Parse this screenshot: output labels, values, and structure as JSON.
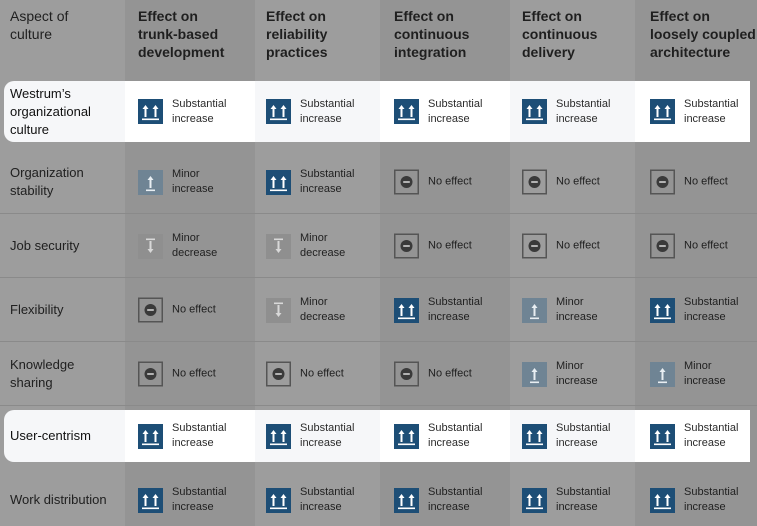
{
  "headers": [
    "Aspect of\nculture",
    "Effect on\ntrunk-based\ndevelopment",
    "Effect on\nreliability\npractices",
    "Effect on\ncontinuous\nintegration",
    "Effect on\ncontinuous\ndelivery",
    "Effect on\nloosely coupled\narchitecture"
  ],
  "colors": {
    "substantial_increase": "#1d4e76",
    "minor_increase": "#6f8494",
    "minor_decrease": "#8f8f8f",
    "no_effect_border": "#555555",
    "overlay_bg": "#9d9d9d",
    "highlight_bg": "#ffffff"
  },
  "rows": [
    {
      "aspect": "Westrum’s\norganizational\nculture",
      "highlighted": true,
      "effects": [
        {
          "type": "substantial_increase",
          "icon": "double-up-arrow-icon",
          "label": "Substantial\nincrease"
        },
        {
          "type": "substantial_increase",
          "icon": "double-up-arrow-icon",
          "label": "Substantial\nincrease"
        },
        {
          "type": "substantial_increase",
          "icon": "double-up-arrow-icon",
          "label": "Substantial\nincrease"
        },
        {
          "type": "substantial_increase",
          "icon": "double-up-arrow-icon",
          "label": "Substantial\nincrease"
        },
        {
          "type": "substantial_increase",
          "icon": "double-up-arrow-icon",
          "label": "Substantial\nincrease"
        }
      ]
    },
    {
      "aspect": "Organization\nstability",
      "highlighted": false,
      "effects": [
        {
          "type": "minor_increase",
          "icon": "up-arrow-icon",
          "label": "Minor\nincrease"
        },
        {
          "type": "substantial_increase",
          "icon": "double-up-arrow-icon",
          "label": "Substantial\nincrease"
        },
        {
          "type": "no_effect",
          "icon": "no-effect-icon",
          "label": "No effect"
        },
        {
          "type": "no_effect",
          "icon": "no-effect-icon",
          "label": "No effect"
        },
        {
          "type": "no_effect",
          "icon": "no-effect-icon",
          "label": "No effect"
        }
      ]
    },
    {
      "aspect": "Job security",
      "highlighted": false,
      "effects": [
        {
          "type": "minor_decrease",
          "icon": "down-arrow-icon",
          "label": "Minor\ndecrease"
        },
        {
          "type": "minor_decrease",
          "icon": "down-arrow-icon",
          "label": "Minor\ndecrease"
        },
        {
          "type": "no_effect",
          "icon": "no-effect-icon",
          "label": "No effect"
        },
        {
          "type": "no_effect",
          "icon": "no-effect-icon",
          "label": "No effect"
        },
        {
          "type": "no_effect",
          "icon": "no-effect-icon",
          "label": "No effect"
        }
      ]
    },
    {
      "aspect": "Flexibility",
      "highlighted": false,
      "effects": [
        {
          "type": "no_effect",
          "icon": "no-effect-icon",
          "label": "No effect"
        },
        {
          "type": "minor_decrease",
          "icon": "down-arrow-icon",
          "label": "Minor\ndecrease"
        },
        {
          "type": "substantial_increase",
          "icon": "double-up-arrow-icon",
          "label": "Substantial\nincrease"
        },
        {
          "type": "minor_increase",
          "icon": "up-arrow-icon",
          "label": "Minor\nincrease"
        },
        {
          "type": "substantial_increase",
          "icon": "double-up-arrow-icon",
          "label": "Substantial\nincrease"
        }
      ]
    },
    {
      "aspect": "Knowledge\nsharing",
      "highlighted": false,
      "effects": [
        {
          "type": "no_effect",
          "icon": "no-effect-icon",
          "label": "No effect"
        },
        {
          "type": "no_effect",
          "icon": "no-effect-icon",
          "label": "No effect"
        },
        {
          "type": "no_effect",
          "icon": "no-effect-icon",
          "label": "No effect"
        },
        {
          "type": "minor_increase",
          "icon": "up-arrow-icon",
          "label": "Minor\nincrease"
        },
        {
          "type": "minor_increase",
          "icon": "up-arrow-icon",
          "label": "Minor\nincrease"
        }
      ]
    },
    {
      "aspect": "User-centrism",
      "highlighted": true,
      "effects": [
        {
          "type": "substantial_increase",
          "icon": "double-up-arrow-icon",
          "label": "Substantial\nincrease"
        },
        {
          "type": "substantial_increase",
          "icon": "double-up-arrow-icon",
          "label": "Substantial\nincrease"
        },
        {
          "type": "substantial_increase",
          "icon": "double-up-arrow-icon",
          "label": "Substantial\nincrease"
        },
        {
          "type": "substantial_increase",
          "icon": "double-up-arrow-icon",
          "label": "Substantial\nincrease"
        },
        {
          "type": "substantial_increase",
          "icon": "double-up-arrow-icon",
          "label": "Substantial\nincrease"
        }
      ]
    },
    {
      "aspect": "Work distribution",
      "highlighted": false,
      "effects": [
        {
          "type": "substantial_increase",
          "icon": "double-up-arrow-icon",
          "label": "Substantial\nincrease"
        },
        {
          "type": "substantial_increase",
          "icon": "double-up-arrow-icon",
          "label": "Substantial\nincrease"
        },
        {
          "type": "substantial_increase",
          "icon": "double-up-arrow-icon",
          "label": "Substantial\nincrease"
        },
        {
          "type": "substantial_increase",
          "icon": "double-up-arrow-icon",
          "label": "Substantial\nincrease"
        },
        {
          "type": "substantial_increase",
          "icon": "double-up-arrow-icon",
          "label": "Substantial\nincrease"
        }
      ]
    }
  ]
}
